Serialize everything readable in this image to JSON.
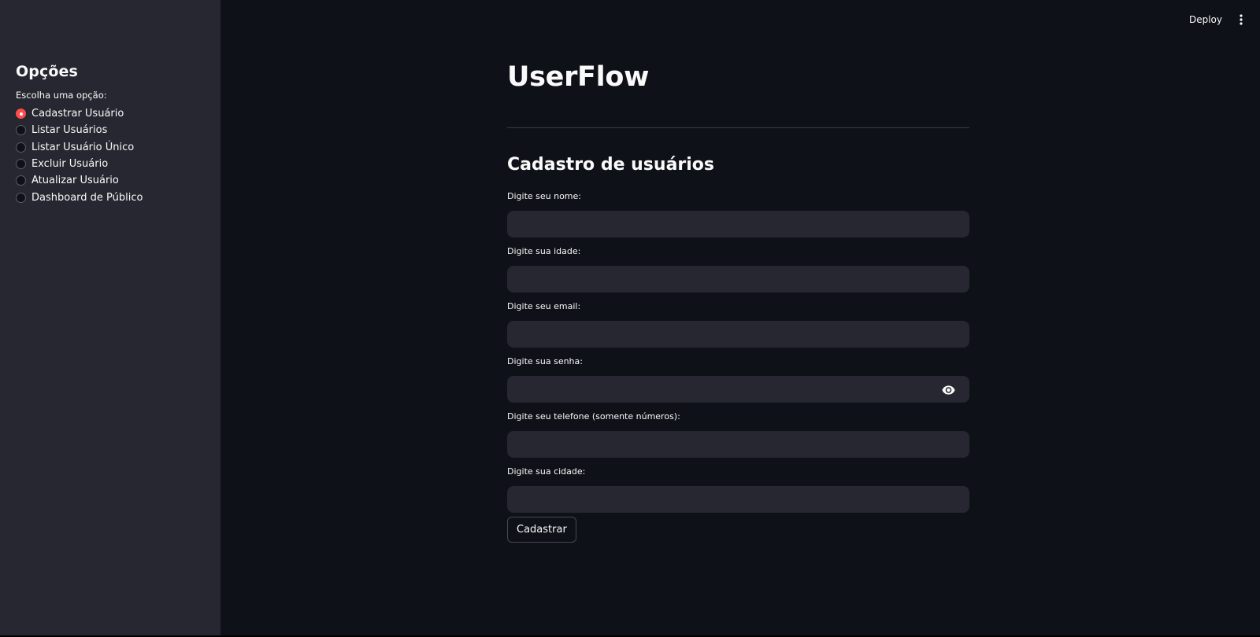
{
  "sidebar": {
    "title": "Opções",
    "radio_label": "Escolha uma opção:",
    "options": [
      {
        "label": "Cadastrar Usuário",
        "selected": true
      },
      {
        "label": "Listar Usuários",
        "selected": false
      },
      {
        "label": "Listar Usuário Único",
        "selected": false
      },
      {
        "label": "Excluir Usuário",
        "selected": false
      },
      {
        "label": "Atualizar Usuário",
        "selected": false
      },
      {
        "label": "Dashboard de Público",
        "selected": false
      }
    ]
  },
  "toolbar": {
    "deploy_label": "Deploy",
    "menu_icon": "vertical-dots-icon"
  },
  "main": {
    "title": "UserFlow",
    "section_title": "Cadastro de usuários",
    "fields": [
      {
        "label": "Digite seu nome:",
        "value": ""
      },
      {
        "label": "Digite sua idade:",
        "value": ""
      },
      {
        "label": "Digite seu email:",
        "value": ""
      },
      {
        "label": "Digite sua senha:",
        "value": "",
        "type": "password",
        "icon": "eye-icon"
      },
      {
        "label": "Digite seu telefone (somente números):",
        "value": ""
      },
      {
        "label": "Digite sua cidade:",
        "value": ""
      }
    ],
    "submit_label": "Cadastrar"
  },
  "colors": {
    "background": "#0e1117",
    "sidebar": "#262730",
    "input": "#262730",
    "accent": "#ff4b4b",
    "text": "#fafafa"
  }
}
